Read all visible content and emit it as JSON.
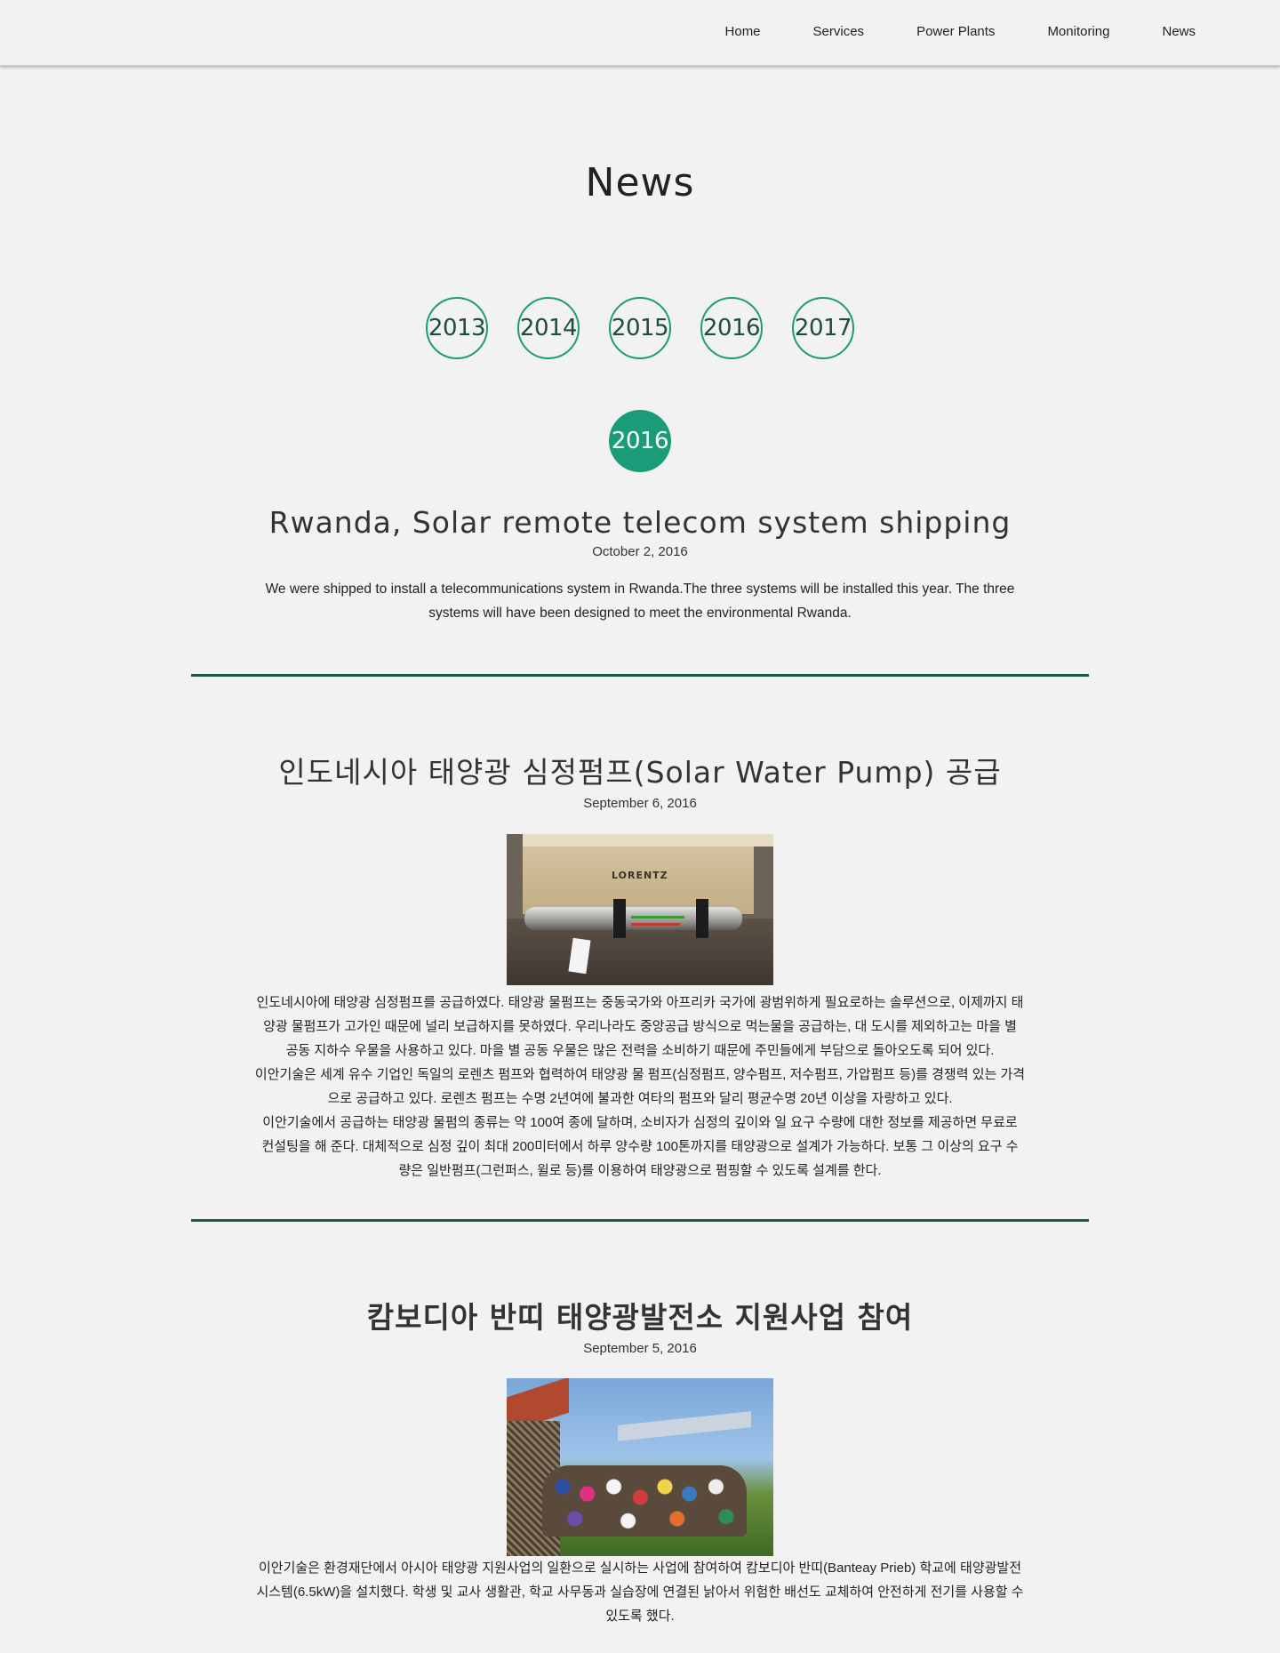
{
  "nav": {
    "items": [
      {
        "label": "Home"
      },
      {
        "label": "Services"
      },
      {
        "label": "Power Plants"
      },
      {
        "label": "Monitoring"
      },
      {
        "label": "News"
      }
    ]
  },
  "page": {
    "title": "News"
  },
  "years": [
    "2013",
    "2014",
    "2015",
    "2016",
    "2017"
  ],
  "current_year": "2016",
  "posts": [
    {
      "title": "Rwanda, Solar remote telecom system shipping",
      "date": "October 2, 2016",
      "body": [
        "We were shipped to install a telecommunications system in Rwanda.The three systems will be installed this year. The three",
        "systems will have been designed to meet the environmental Rwanda."
      ]
    },
    {
      "title": "인도네시아 태양광 심정펌프(Solar Water Pump) 공급",
      "date": "September 6, 2016",
      "image_text": "LORENTZ",
      "body": [
        "인도네시아에 태양광 심정펌프를 공급하였다. 태양광 물펌프는 중동국가와 아프리카 국가에 광범위하게 필요로하는 솔루션으로, 이제까지 태",
        "양광 물펌프가 고가인 때문에 널리 보급하지를 못하였다. 우리나라도 중앙공급 방식으로 먹는물을 공급하는, 대 도시를 제외하고는 마을 별",
        "공동 지하수 우물을 사용하고 있다. 마을 별 공동 우물은 많은 전력을 소비하기 때문에 주민들에게 부담으로 돌아오도록 되어 있다.",
        "이안기술은 세계 유수 기업인 독일의 로렌츠 펌프와 협력하여 태양광 물 펌프(심정펌프, 양수펌프, 저수펌프, 가압펌프 등)를 경쟁력 있는 가격",
        "으로 공급하고 있다. 로렌츠 펌프는 수명 2년여에 불과한 여타의 펌프와 달리 평균수명 20년 이상을 자랑하고 있다.",
        "이안기술에서 공급하는 태양광 물펌의 종류는 약 100여 종에 달하며, 소비자가 심정의 깊이와 일 요구 수량에 대한 정보를 제공하면 무료로",
        "컨설팅을 해 준다. 대체적으로 심정 깊이 최대  200미터에서 하루 양수량 100톤까지를 태양광으로 설계가 가능하다. 보통 그 이상의 요구 수",
        "량은 일반펌프(그런퍼스, 윌로 등)를 이용하여 태양광으로 펌핑할 수 있도록 설계를 한다."
      ]
    },
    {
      "title": "캄보디아 반띠 태양광발전소 지원사업 참여",
      "date": "September 5, 2016",
      "body": [
        "이안기술은 환경재단에서 아시아 태양광 지원사업의 일환으로 실시하는 사업에 참여하여 캄보디아 반띠(Banteay Prieb) 학교에 태양광발전",
        "시스템(6.5kW)을 설치했다. 학생 및 교사 생활관, 학교 사무동과 실습장에 연결된 낡아서 위험한 배선도 교체하여 안전하게 전기를 사용할 수",
        "있도록 했다."
      ]
    }
  ],
  "colors": {
    "accent": "#1b9c78",
    "divider": "#1c5a42",
    "background": "#f2f2f2"
  }
}
